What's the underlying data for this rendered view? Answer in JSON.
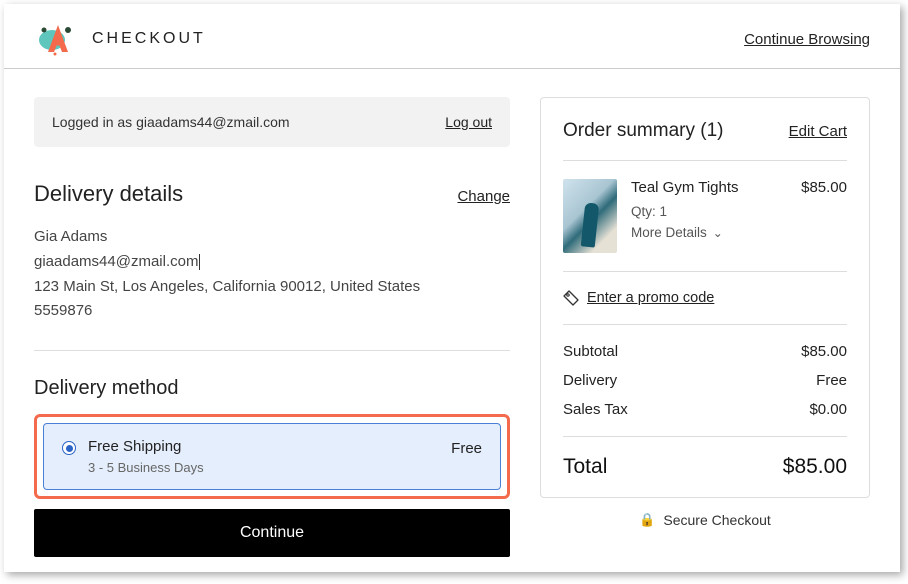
{
  "header": {
    "brand": "CHECKOUT",
    "continue_browsing": "Continue Browsing"
  },
  "login": {
    "text": "Logged in as giaadams44@zmail.com",
    "logout": "Log out"
  },
  "delivery": {
    "title": "Delivery details",
    "change": "Change",
    "name": "Gia Adams",
    "email": "giaadams44@zmail.com",
    "address": "123 Main St, Los Angeles, California 90012, United States",
    "phone": "5559876"
  },
  "method": {
    "title": "Delivery method",
    "options": [
      {
        "label": "Free Shipping",
        "eta": "3 - 5 Business Days",
        "price": "Free",
        "selected": true
      }
    ]
  },
  "continue_button": "Continue",
  "summary": {
    "title": "Order summary (1)",
    "edit": "Edit Cart",
    "item": {
      "name": "Teal Gym Tights",
      "price": "$85.00",
      "qty": "Qty: 1",
      "more": "More Details"
    },
    "promo": "Enter a promo code",
    "subtotal_label": "Subtotal",
    "subtotal_value": "$85.00",
    "delivery_label": "Delivery",
    "delivery_value": "Free",
    "tax_label": "Sales Tax",
    "tax_value": "$0.00",
    "total_label": "Total",
    "total_value": "$85.00"
  },
  "secure": "Secure Checkout"
}
